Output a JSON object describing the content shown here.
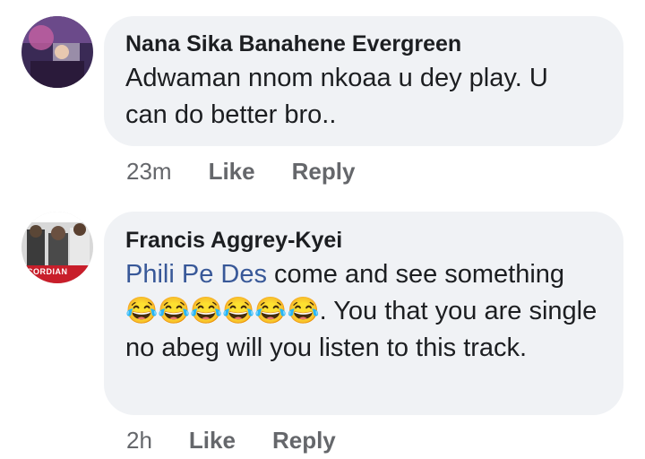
{
  "comments": [
    {
      "author": "Nana Sika Banahene Evergreen",
      "text": "Adwaman nnom nkoaa u dey play. U can do better bro..",
      "time": "23m",
      "like_label": "Like",
      "reply_label": "Reply"
    },
    {
      "author": "Francis Aggrey-Kyei",
      "mention": "Phili Pe Des",
      "text_after_mention": " come and see something 😂😂😂😂😂😂. You that you are single no abeg will you listen to this track.",
      "time": "2h",
      "like_label": "Like",
      "reply_label": "Reply",
      "avatar_caption": "CORDIAN"
    }
  ],
  "colors": {
    "bubble": "#f0f2f5",
    "mention": "#385898",
    "meta": "#65676b"
  }
}
